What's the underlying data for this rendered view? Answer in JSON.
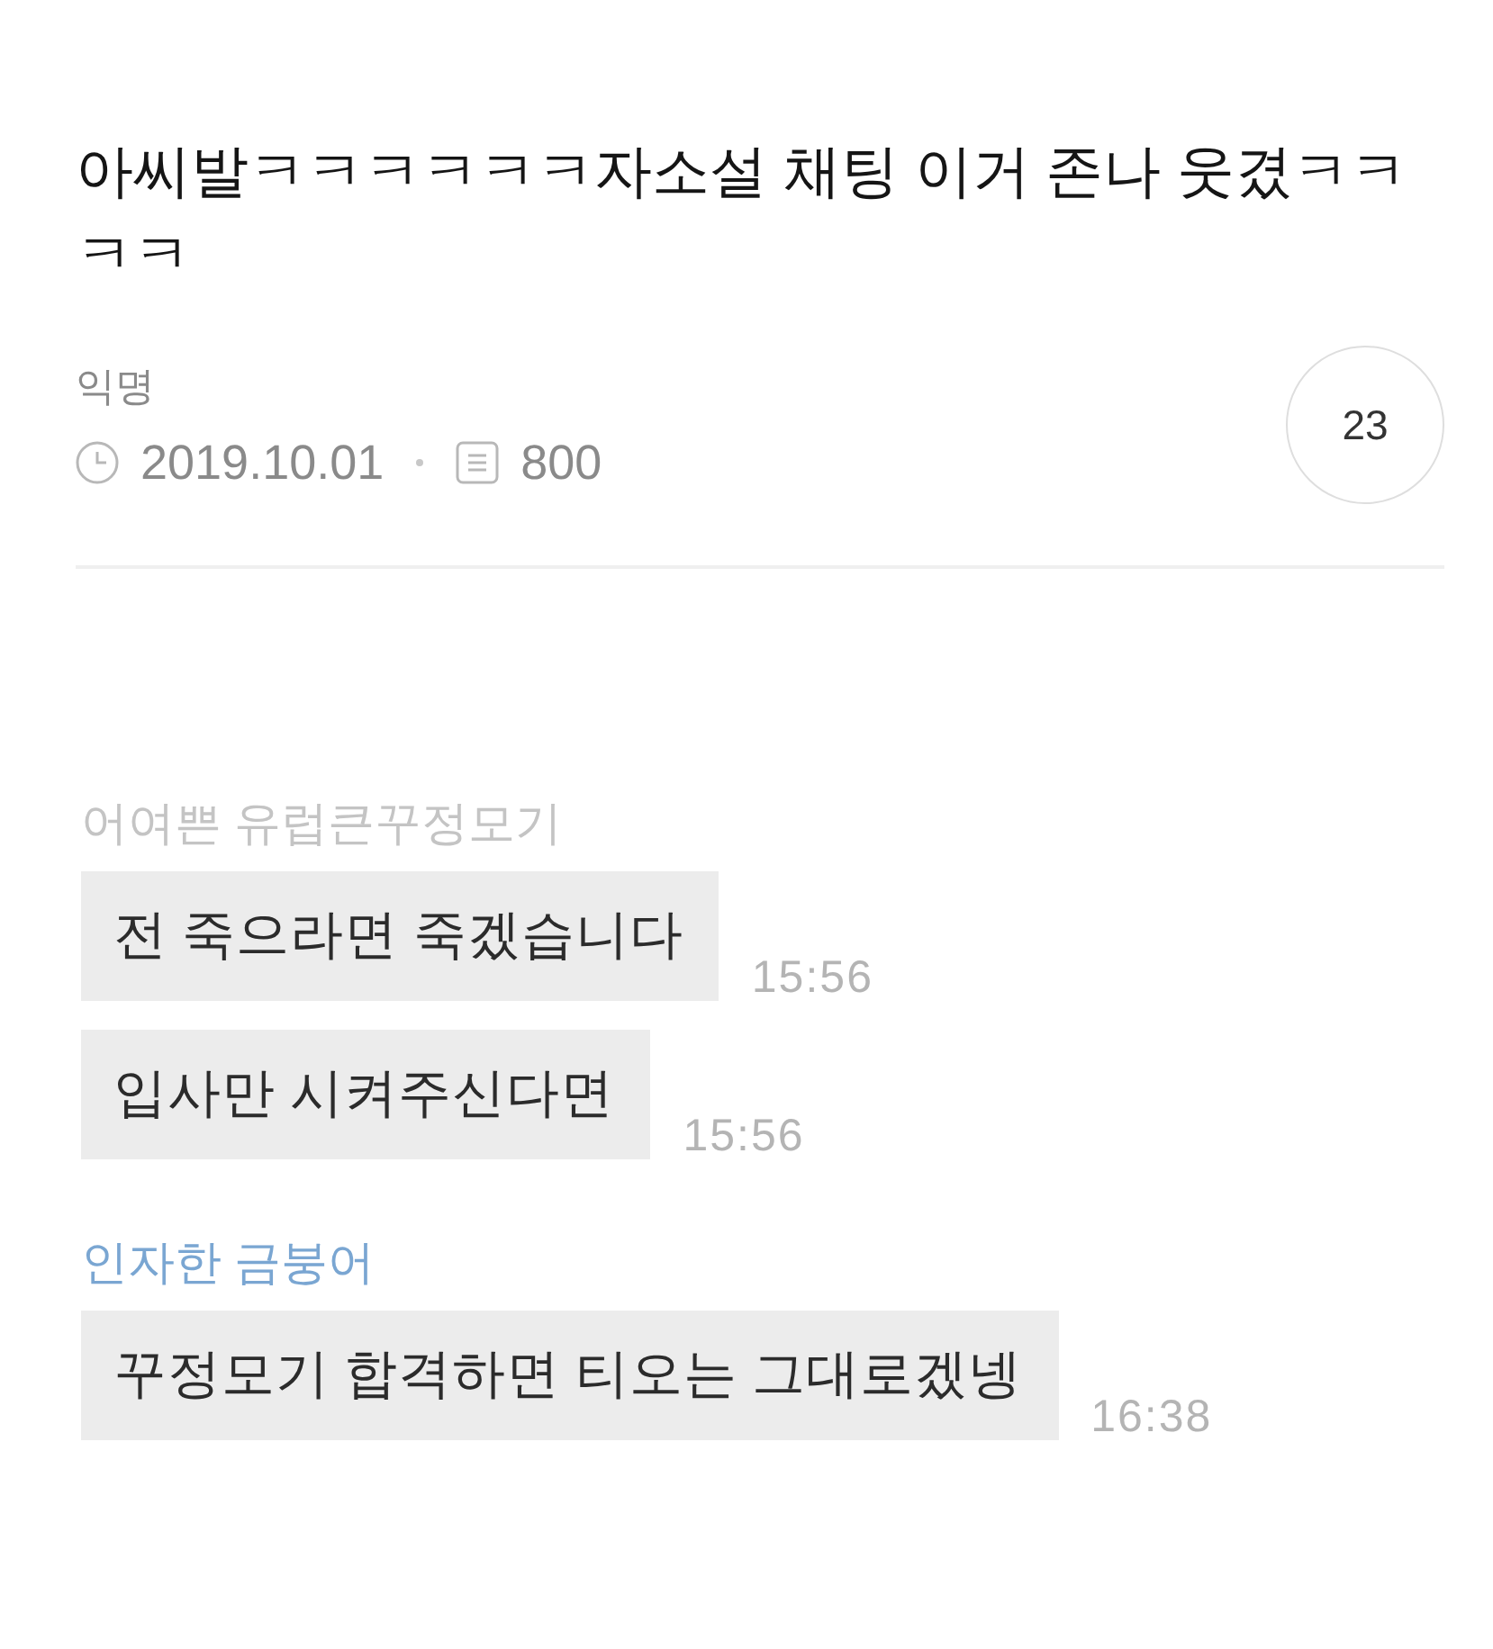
{
  "post": {
    "title": "아씨발ㅋㅋㅋㅋㅋㅋ자소설 채팅 이거 존나 웃겼ㅋㅋㅋㅋ",
    "author": "익명",
    "date": "2019.10.01",
    "views": "800",
    "comment_count": "23"
  },
  "chat": [
    {
      "sender": "어여쁜 유럽큰꾸정모기",
      "color": "#c4c4c4",
      "messages": [
        {
          "text": "전 죽으라면 죽겠습니다",
          "time": "15:56"
        },
        {
          "text": "입사만 시켜주신다면",
          "time": "15:56"
        }
      ]
    },
    {
      "sender": "인자한 금붕어",
      "color": "#7aa6d2",
      "messages": [
        {
          "text": "꾸정모기 합격하면 티오는 그대로겠넹",
          "time": "16:38"
        }
      ]
    }
  ]
}
